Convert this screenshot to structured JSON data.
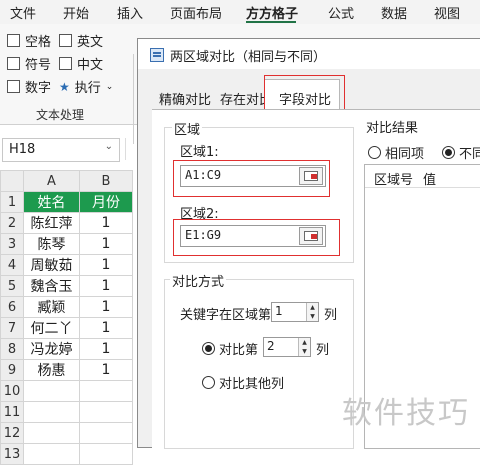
{
  "ribbon": {
    "tabs": [
      "文件",
      "开始",
      "插入",
      "页面布局",
      "方方格子",
      "公式",
      "数据",
      "视图"
    ],
    "active_tab": "方方格子",
    "accent": "#217346",
    "checkboxes": [
      "空格",
      "英文",
      "符号",
      "中文",
      "数字"
    ],
    "execute_label": "执行",
    "group_label": "文本处理"
  },
  "namebox": {
    "value": "H18"
  },
  "sheet": {
    "columns": [
      "A",
      "B"
    ],
    "rows": [
      {
        "num": "1",
        "a": "姓名",
        "b": "月份"
      },
      {
        "num": "2",
        "a": "陈红萍",
        "b": "1"
      },
      {
        "num": "3",
        "a": "陈琴",
        "b": "1"
      },
      {
        "num": "4",
        "a": "周敏茹",
        "b": "1"
      },
      {
        "num": "5",
        "a": "魏含玉",
        "b": "1"
      },
      {
        "num": "6",
        "a": "臧颖",
        "b": "1"
      },
      {
        "num": "7",
        "a": "何二丫",
        "b": "1"
      },
      {
        "num": "8",
        "a": "冯龙婷",
        "b": "1"
      },
      {
        "num": "9",
        "a": "杨惠",
        "b": "1"
      },
      {
        "num": "10",
        "a": "",
        "b": ""
      },
      {
        "num": "11",
        "a": "",
        "b": ""
      },
      {
        "num": "12",
        "a": "",
        "b": ""
      },
      {
        "num": "13",
        "a": "",
        "b": ""
      }
    ],
    "header_fill": "#1d9a4e"
  },
  "dialog": {
    "title": "两区域对比（相同与不同）",
    "tabs": [
      "精确对比",
      "存在对比",
      "字段对比"
    ],
    "active_tab": "字段对比",
    "region_group": "区域",
    "region1_label": "区域1:",
    "region1_value": "A1:C9",
    "region2_label": "区域2:",
    "region2_value": "E1:G9",
    "compare_group": "对比方式",
    "key_label": "关键字在区域第",
    "key_value": "1",
    "col_unit": "列",
    "compare_nth_label": "对比第",
    "compare_nth_value": "2",
    "compare_other_label": "对比其他列",
    "result_group": "对比结果",
    "result_same": "相同项",
    "result_diff": "不同",
    "list_col1": "区域号",
    "list_col2": "值",
    "highlight_color": "#e03030"
  },
  "watermark": "软件技巧"
}
